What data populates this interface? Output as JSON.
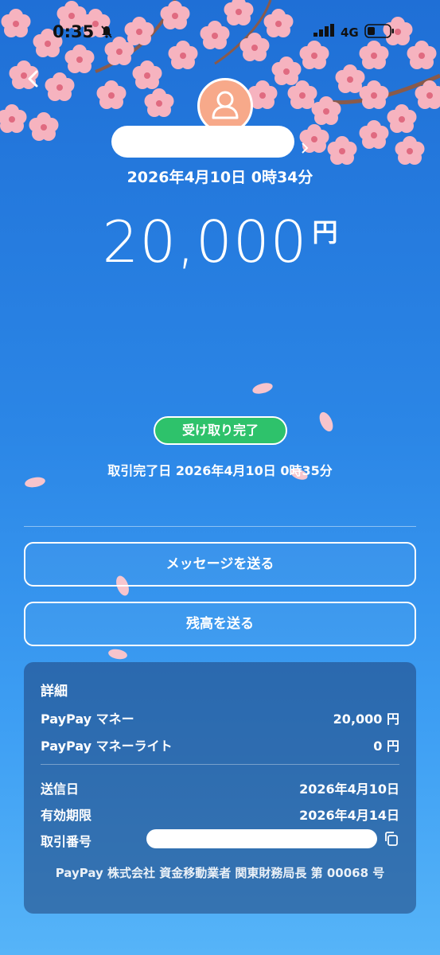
{
  "status_bar": {
    "time": "0:35",
    "network": "4G"
  },
  "transfer": {
    "datetime": "2026年4月10日 0時34分",
    "amount": "20,000",
    "currency": "円",
    "status_badge": "受け取り完了",
    "completed_text": "取引完了日 2026年4月10日 0時35分"
  },
  "actions": {
    "send_message": "メッセージを送る",
    "send_balance": "残高を送る"
  },
  "details": {
    "title": "詳細",
    "paypay_money_label": "PayPay マネー",
    "paypay_money_value": "20,000 円",
    "paypay_money_lite_label": "PayPay マネーライト",
    "paypay_money_lite_value": "0 円",
    "sent_date_label": "送信日",
    "sent_date_value": "2026年4月10日",
    "expiry_label": "有効期限",
    "expiry_value": "2026年4月14日",
    "transaction_id_label": "取引番号",
    "registration": "PayPay 株式会社 資金移動業者 関東財務局長 第 00068 号"
  },
  "colors": {
    "badge": "#2ec26b",
    "background_top": "#1f6fd6",
    "background_bottom": "#56b4f8",
    "blossom": "#f6b3bf"
  },
  "icons": [
    "bell-slash-icon",
    "signal-icon",
    "battery-icon",
    "back-chevron-icon",
    "avatar-person-icon",
    "copy-icon"
  ]
}
